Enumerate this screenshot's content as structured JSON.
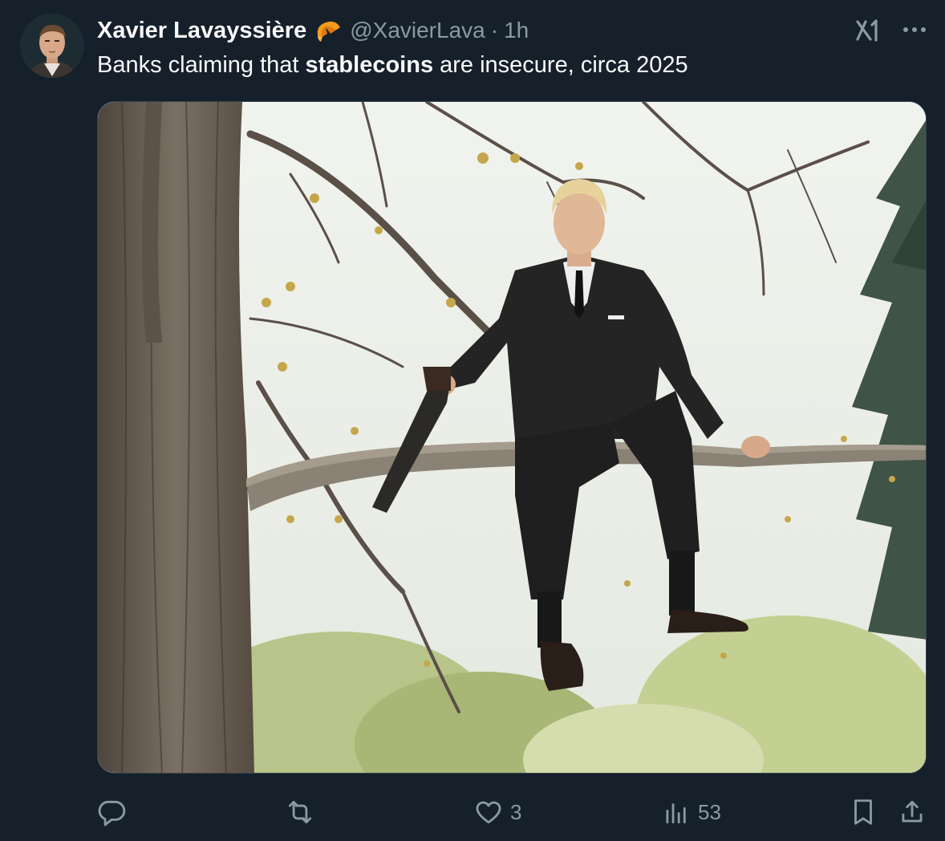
{
  "tweet": {
    "author": {
      "display_name": "Xavier Lavayssière",
      "handle": "@XavierLava",
      "badge_icon": "croissant-icon"
    },
    "separator": "·",
    "timestamp": "1h",
    "text_before": "Banks claiming that ",
    "text_bold": "stablecoins",
    "text_after": " are insecure, circa 2025",
    "media": {
      "kind": "photo",
      "subject": "man-in-suit-sawing-branch-he-sits-on"
    }
  },
  "actions": {
    "reply": {
      "icon": "reply-icon",
      "count": ""
    },
    "retweet": {
      "icon": "retweet-icon",
      "count": ""
    },
    "like": {
      "icon": "heart-icon",
      "count": "3"
    },
    "views": {
      "icon": "views-icon",
      "count": "53"
    },
    "bookmark": {
      "icon": "bookmark-icon"
    },
    "share": {
      "icon": "share-icon"
    }
  },
  "colors": {
    "background": "#15202b",
    "text_primary": "#f7f9f9",
    "text_secondary": "#8b98a5",
    "border": "#38444d",
    "badge": "#f49a1c"
  }
}
